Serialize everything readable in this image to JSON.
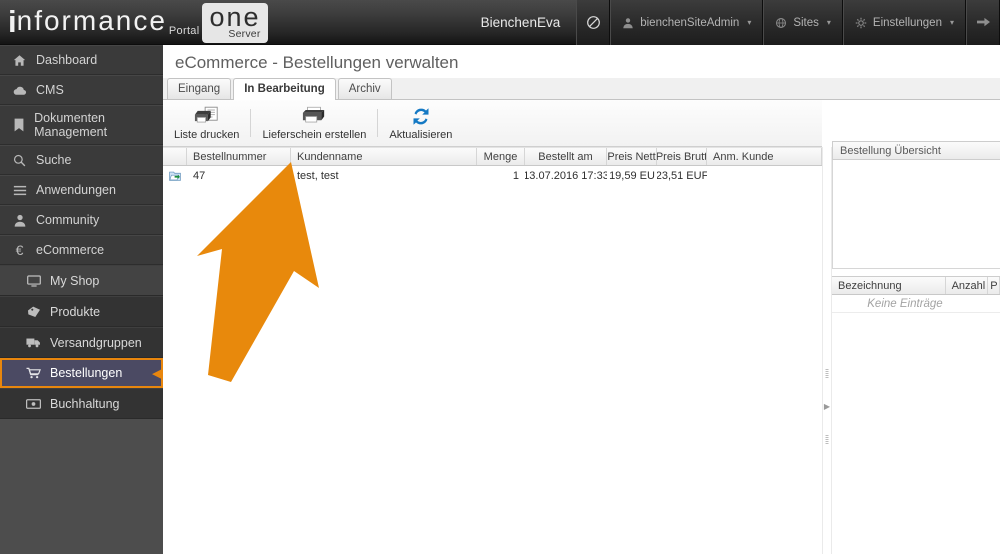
{
  "header": {
    "logo": {
      "i": "i",
      "word": "nformance",
      "portal": "Portal",
      "one": "one",
      "server": "Server"
    },
    "user_display": "BienchenEva",
    "block_icon": "block-icon",
    "buttons": [
      {
        "label": "bienchenSiteAdmin",
        "icon": "user-icon",
        "caret": "▾"
      },
      {
        "label": "Sites",
        "icon": "globe-icon",
        "caret": "▾"
      },
      {
        "label": "Einstellungen",
        "icon": "gear-icon",
        "caret": "▾"
      }
    ],
    "forward_icon": "arrow-right-icon"
  },
  "sidebar": {
    "items": [
      {
        "label": "Dashboard",
        "icon": "home-icon",
        "level": "top"
      },
      {
        "label": "CMS",
        "icon": "cloud-icon",
        "level": "top"
      },
      {
        "label": "Dokumenten Management",
        "icon": "bookmark-icon",
        "level": "top",
        "tall": true
      },
      {
        "label": "Suche",
        "icon": "search-icon",
        "level": "top"
      },
      {
        "label": "Anwendungen",
        "icon": "list-icon",
        "level": "top"
      },
      {
        "label": "Community",
        "icon": "person-icon",
        "level": "top"
      },
      {
        "label": "eCommerce",
        "icon": "euro-icon",
        "level": "top"
      },
      {
        "label": "My Shop",
        "icon": "monitor-icon",
        "level": "sub",
        "alt": true
      },
      {
        "label": "Produkte",
        "icon": "tag-icon",
        "level": "sub"
      },
      {
        "label": "Versandgruppen",
        "icon": "truck-icon",
        "level": "sub"
      },
      {
        "label": "Bestellungen",
        "icon": "cart-icon",
        "level": "sub",
        "selected": true
      },
      {
        "label": "Buchhaltung",
        "icon": "banknote-icon",
        "level": "sub"
      }
    ],
    "selection_color": "#e8860d",
    "selection_bg": "#4b4a63"
  },
  "main": {
    "page_title": "eCommerce - Bestellungen verwalten",
    "tabs": [
      {
        "label": "Eingang",
        "active": false
      },
      {
        "label": "In Bearbeitung",
        "active": true
      },
      {
        "label": "Archiv",
        "active": false
      }
    ],
    "toolbar": [
      {
        "label": "Liste drucken",
        "icon": "print-list-icon"
      },
      {
        "label": "Lieferschein erstellen",
        "icon": "printer-icon"
      },
      {
        "label": "Aktualisieren",
        "icon": "refresh-icon"
      }
    ],
    "grid": {
      "columns": [
        {
          "key": "ico",
          "label": ""
        },
        {
          "key": "num",
          "label": "Bestellnummer"
        },
        {
          "key": "name",
          "label": "Kundenname"
        },
        {
          "key": "menge",
          "label": "Menge"
        },
        {
          "key": "date",
          "label": "Bestellt am"
        },
        {
          "key": "net",
          "label": "Preis Nett"
        },
        {
          "key": "brut",
          "label": "Preis Brutt"
        },
        {
          "key": "anm",
          "label": "Anm. Kunde"
        }
      ],
      "rows": [
        {
          "row_icon": "open-order-icon",
          "num": "47",
          "name": "test, test",
          "menge": "1",
          "date": "13.07.2016 17:33",
          "net": "19,59 EU",
          "brut": "23,51 EUF",
          "anm": ""
        }
      ]
    },
    "splitter": {
      "collapse_icon": "chevron-right-icon"
    }
  },
  "right_panel": {
    "title": "Bestellung Übersicht",
    "table": {
      "columns": [
        "Bezeichnung",
        "Anzahl",
        "P"
      ],
      "empty_text": "Keine Einträge"
    }
  },
  "annotation": {
    "arrow": {
      "color": "#e8890c",
      "points_to": "test, test"
    }
  }
}
